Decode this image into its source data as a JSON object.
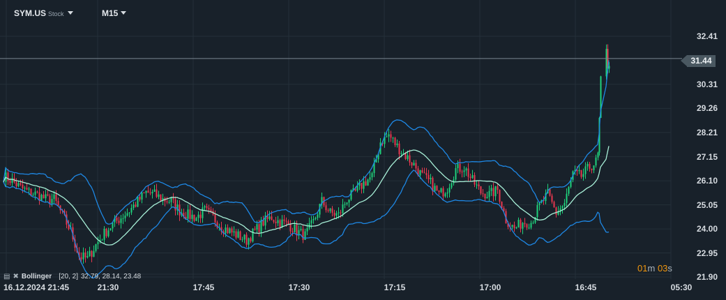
{
  "header": {
    "symbol": "SYM.US",
    "asset_type": "Stock",
    "timeframe": "M15"
  },
  "indicator": {
    "name": "Bollinger",
    "params": "[20, 2]",
    "values": "32.79,  28.14,  23.48"
  },
  "timer": {
    "minutes": "01",
    "min_unit": "m",
    "seconds": "03",
    "sec_unit": "s"
  },
  "current_price": "31.44",
  "colors": {
    "background": "#18212a",
    "grid": "#243039",
    "up": "#1fd17c",
    "down": "#e8384f",
    "bands": "#1e88e5",
    "middle": "#a8f0d8",
    "price_line": "#7a8690",
    "timer": "#f0960e"
  },
  "chart_data": {
    "type": "candlestick",
    "indicator": "Bollinger Bands (20, 2)",
    "y_ticks": [
      "32.41",
      "30.31",
      "29.26",
      "28.21",
      "27.15",
      "26.10",
      "25.05",
      "24.00",
      "22.95",
      "21.90"
    ],
    "ylim": [
      21.9,
      32.41
    ],
    "x_ticks": [
      "16.12.2024  21:45",
      "21:30",
      "17:45",
      "17:30",
      "17:15",
      "17:00",
      "16:45",
      "05:30"
    ],
    "grid": true,
    "approx_closes": [
      26.3,
      26.1,
      25.8,
      25.6,
      25.5,
      25.3,
      25.3,
      24.6,
      23.9,
      22.8,
      22.7,
      23.3,
      23.8,
      24.2,
      24.5,
      24.8,
      25.2,
      25.6,
      25.5,
      25.3,
      25.2,
      24.8,
      24.6,
      24.5,
      24.8,
      24.5,
      24.1,
      23.9,
      23.7,
      23.5,
      23.9,
      24.3,
      24.5,
      24.3,
      24.2,
      23.9,
      23.7,
      24.3,
      25.2,
      24.7,
      24.6,
      25.3,
      25.6,
      26.0,
      26.3,
      27.8,
      28.1,
      27.6,
      27.2,
      26.8,
      26.3,
      26.0,
      25.5,
      25.8,
      26.6,
      26.7,
      26.1,
      25.6,
      25.5,
      25.7,
      24.4,
      24.0,
      24.3,
      24.3,
      25.0,
      25.5,
      24.7,
      25.1,
      26.4,
      26.3,
      26.7,
      27.0,
      31.4,
      31.6
    ]
  }
}
